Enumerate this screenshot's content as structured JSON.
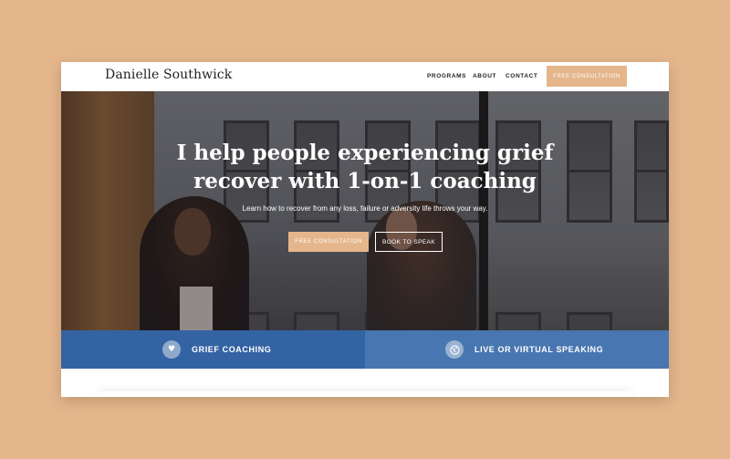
{
  "site": {
    "logo": "Danielle Southwick"
  },
  "nav": {
    "programs": "PROGRAMS",
    "about": "ABOUT",
    "contact": "CONTACT",
    "cta": "FREE CONSULTATION"
  },
  "hero": {
    "title_line1": "I help people experiencing grief",
    "title_line2": "recover with 1-on-1 coaching",
    "subtitle": "Learn how to recover from any loss, failure or adversity life throws your way.",
    "primary_button": "FREE CONSULTATION",
    "secondary_button": "BOOK TO SPEAK"
  },
  "features": [
    {
      "label": "GRIEF COACHING",
      "icon": "heart-icon"
    },
    {
      "label": "LIVE OR VIRTUAL SPEAKING",
      "icon": "globe-icon"
    }
  ],
  "colors": {
    "background": "#e5b68c",
    "accent": "#e5b68c",
    "feature_left": "#3463a4",
    "feature_right": "#4876b0"
  }
}
